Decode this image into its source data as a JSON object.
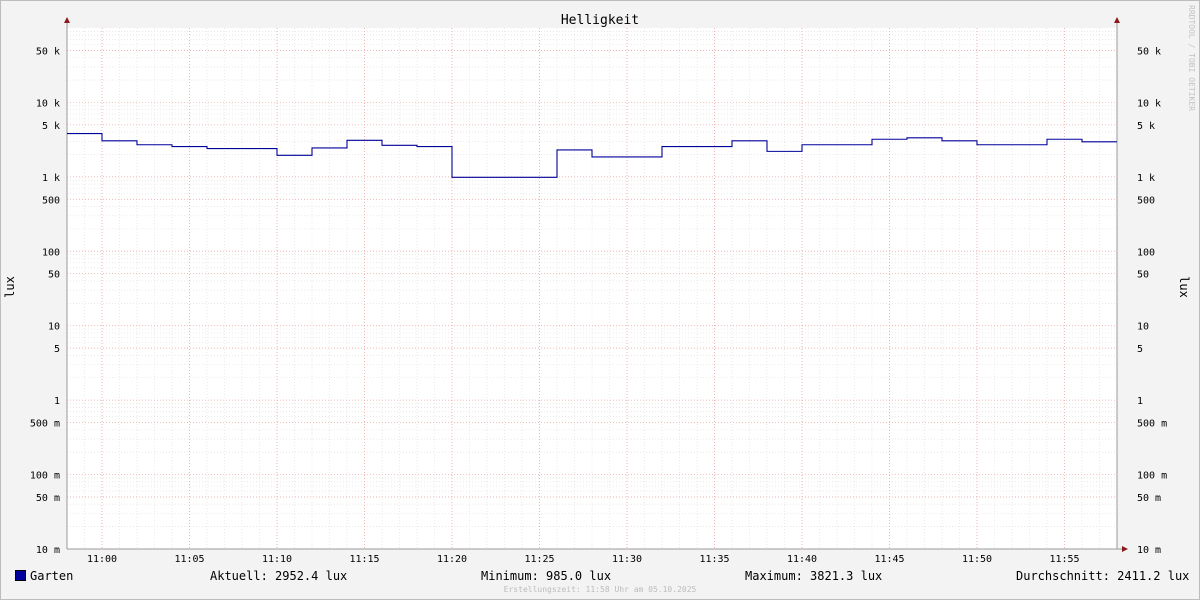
{
  "chart_data": {
    "type": "line",
    "title": "Helligkeit",
    "ylabel": "lux",
    "yscale": "log",
    "ylim": [
      0.01,
      100000
    ],
    "xlim": [
      "10:58:00",
      "11:58:00"
    ],
    "y_ticks": [
      {
        "value": 50000,
        "label": "50 k"
      },
      {
        "value": 10000,
        "label": "10 k"
      },
      {
        "value": 5000,
        "label": "5 k"
      },
      {
        "value": 1000,
        "label": "1 k"
      },
      {
        "value": 500,
        "label": "500"
      },
      {
        "value": 100,
        "label": "100"
      },
      {
        "value": 50,
        "label": "50"
      },
      {
        "value": 10,
        "label": "10"
      },
      {
        "value": 5,
        "label": "5"
      },
      {
        "value": 1,
        "label": "1"
      },
      {
        "value": 0.5,
        "label": "500 m"
      },
      {
        "value": 0.1,
        "label": "100 m"
      },
      {
        "value": 0.05,
        "label": "50 m"
      },
      {
        "value": 0.01,
        "label": "10 m"
      }
    ],
    "x_ticks": [
      "11:00",
      "11:05",
      "11:10",
      "11:15",
      "11:20",
      "11:25",
      "11:30",
      "11:35",
      "11:40",
      "11:45",
      "11:50",
      "11:55"
    ],
    "grid": true,
    "series": [
      {
        "name": "Garten",
        "color": "#00009c",
        "step": true,
        "x": [
          "10:58:00",
          "11:00:00",
          "11:02:00",
          "11:04:00",
          "11:06:00",
          "11:08:00",
          "11:10:00",
          "11:12:00",
          "11:14:00",
          "11:16:00",
          "11:18:00",
          "11:20:00",
          "11:22:00",
          "11:24:00",
          "11:26:00",
          "11:28:00",
          "11:30:00",
          "11:32:00",
          "11:34:00",
          "11:36:00",
          "11:38:00",
          "11:40:00",
          "11:42:00",
          "11:44:00",
          "11:46:00",
          "11:48:00",
          "11:50:00",
          "11:52:00",
          "11:54:00",
          "11:56:00",
          "11:58:00"
        ],
        "values": [
          3821.3,
          3050,
          2700,
          2550,
          2400,
          2400,
          1950,
          2450,
          3100,
          2650,
          2550,
          985,
          985,
          985,
          2300,
          1850,
          1850,
          2550,
          2550,
          3050,
          2200,
          2700,
          2700,
          3200,
          3350,
          3050,
          2700,
          2700,
          3200,
          2952.4,
          2952.4
        ]
      }
    ]
  },
  "legend": {
    "series_name": "Garten",
    "current": "Aktuell: 2952.4 lux",
    "minimum": "Minimum: 985.0 lux",
    "maximum": "Maximum: 3821.3 lux",
    "average": "Durchschnitt: 2411.2 lux"
  },
  "footer": "Erstellungszeit: 11:58 Uhr am 05.10.2025",
  "watermark": "RRDTOOL / TOBI OETIKER"
}
